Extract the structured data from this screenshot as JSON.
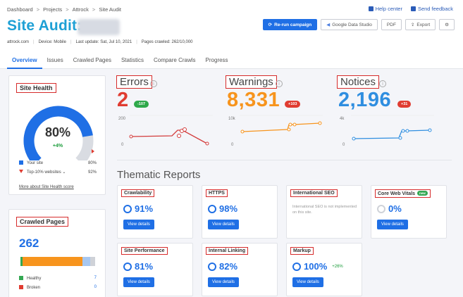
{
  "breadcrumb": [
    "Dashboard",
    "Projects",
    "Attrock",
    "Site Audit"
  ],
  "toplinks": {
    "help": "Help center",
    "feedback": "Send feedback"
  },
  "title": "Site Audit:",
  "actions": {
    "rerun": "Re-run campaign",
    "gds": "Google Data Studio",
    "pdf": "PDF",
    "export": "Export"
  },
  "meta": {
    "domain": "attrock.com",
    "device": "Device: Mobile",
    "last_update": "Last update: Sat, Jul 10, 2021",
    "pages_crawled": "Pages crawled: 262/10,000"
  },
  "tabs": [
    "Overview",
    "Issues",
    "Crawled Pages",
    "Statistics",
    "Compare Crawls",
    "Progress"
  ],
  "site_health": {
    "label": "Site Health",
    "value": "80%",
    "value_fraction": 0.8,
    "delta": "+4%",
    "legend": [
      {
        "name": "Your site",
        "value": "80%"
      },
      {
        "name": "Top-10% websites",
        "value": "92%"
      }
    ],
    "more_link": "More about Site Health score"
  },
  "crawled_pages": {
    "label": "Crawled Pages",
    "value": "262",
    "rows": [
      {
        "name": "Healthy",
        "value": "7"
      },
      {
        "name": "Broken",
        "value": "0"
      }
    ]
  },
  "metrics": {
    "errors": {
      "label": "Errors",
      "value": "2",
      "delta": "-107",
      "color": "#e03c31",
      "delta_color": "#2ea84a",
      "y_top": "200",
      "y_bottom": "0"
    },
    "warnings": {
      "label": "Warnings",
      "value": "8,331",
      "delta": "+103",
      "color": "#f7941d",
      "delta_color": "#e03c31",
      "y_top": "10k",
      "y_bottom": "0"
    },
    "notices": {
      "label": "Notices",
      "value": "2,196",
      "delta": "+31",
      "color": "#2f8ee0",
      "delta_color": "#e03c31",
      "y_top": "4k",
      "y_bottom": "0"
    }
  },
  "thematic": {
    "title": "Thematic Reports",
    "view_label": "View details",
    "cards": [
      {
        "name": "Crawlability",
        "value": "91%"
      },
      {
        "name": "HTTPS",
        "value": "98%"
      },
      {
        "name": "International SEO",
        "note": "International SEO is not implemented on this site."
      },
      {
        "name": "Core Web Vitals",
        "badge": "new",
        "value": "0%"
      },
      {
        "name": "Site Performance",
        "value": "81%"
      },
      {
        "name": "Internal Linking",
        "value": "82%"
      },
      {
        "name": "Markup",
        "value": "100%",
        "delta": "+26%"
      }
    ]
  },
  "colors": {
    "accent": "#1f6fe5",
    "title": "#1ea0d5",
    "annotation": "#d62b2b"
  }
}
